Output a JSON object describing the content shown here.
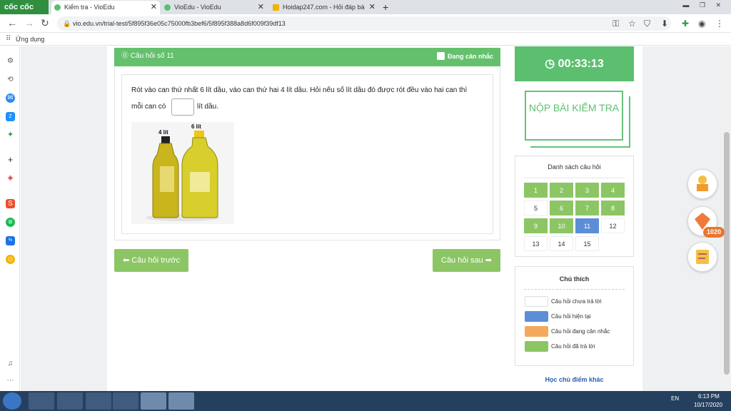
{
  "browser": {
    "brand": "cốc cốc",
    "tabs": [
      {
        "title": "Kiểm tra - VioEdu",
        "active": true
      },
      {
        "title": "VioEdu - VioEdu",
        "active": false
      },
      {
        "title": "Hoidap247.com - Hỏi đáp bà",
        "active": false
      }
    ],
    "url": "vio.edu.vn/trial-test/5f895f36e05c75000fb3bef6/5f895f388a8d6f009f39df13",
    "bookmark_label": "Ứng dụng"
  },
  "question": {
    "header": "Câu hỏi số 11",
    "flag_label": "Đang cân nhắc",
    "text_line1": "Rót vào can thứ nhất 6 lít dầu, vào can thứ hai 4 lít dầu. Hỏi nếu số lít dầu đó được rót đều vào hai can thì",
    "text_prefix": "mỗi can có",
    "answer_value": "",
    "text_suffix": "lít dầu.",
    "image_labels": {
      "small": "4 lít",
      "large": "6 lít"
    }
  },
  "nav": {
    "prev": "Câu hỏi trước",
    "next": "Câu hỏi sau"
  },
  "timer": "00:33:13",
  "submit": "NỘP BÀI KIỂM TRA",
  "question_list": {
    "title": "Danh sách câu hỏi",
    "items": [
      {
        "n": "1",
        "state": "done"
      },
      {
        "n": "2",
        "state": "done"
      },
      {
        "n": "3",
        "state": "done"
      },
      {
        "n": "4",
        "state": "done"
      },
      {
        "n": "5",
        "state": "none"
      },
      {
        "n": "6",
        "state": "done"
      },
      {
        "n": "7",
        "state": "done"
      },
      {
        "n": "8",
        "state": "done"
      },
      {
        "n": "9",
        "state": "done"
      },
      {
        "n": "10",
        "state": "done"
      },
      {
        "n": "11",
        "state": "current"
      },
      {
        "n": "12",
        "state": "none"
      },
      {
        "n": "13",
        "state": "none"
      },
      {
        "n": "14",
        "state": "none"
      },
      {
        "n": "15",
        "state": "none"
      }
    ]
  },
  "legend": {
    "title": "Chú thích",
    "items": [
      {
        "label": "Câu hỏi chưa trả lời",
        "color": "#ffffff"
      },
      {
        "label": "Câu hỏi hiện tại",
        "color": "#5b8ed6"
      },
      {
        "label": "Câu hỏi đang cân nhắc",
        "color": "#f3a85c"
      },
      {
        "label": "Câu hỏi đã trả lời",
        "color": "#8cc664"
      }
    ]
  },
  "more_link": "Học chủ điểm khác",
  "gems_count": "1020",
  "taskbar": {
    "lang": "EN",
    "time": "6:13 PM",
    "date": "10/17/2020"
  },
  "colors": {
    "green": "#64c06c",
    "blue": "#5b8ed6",
    "orange": "#f3a85c"
  }
}
